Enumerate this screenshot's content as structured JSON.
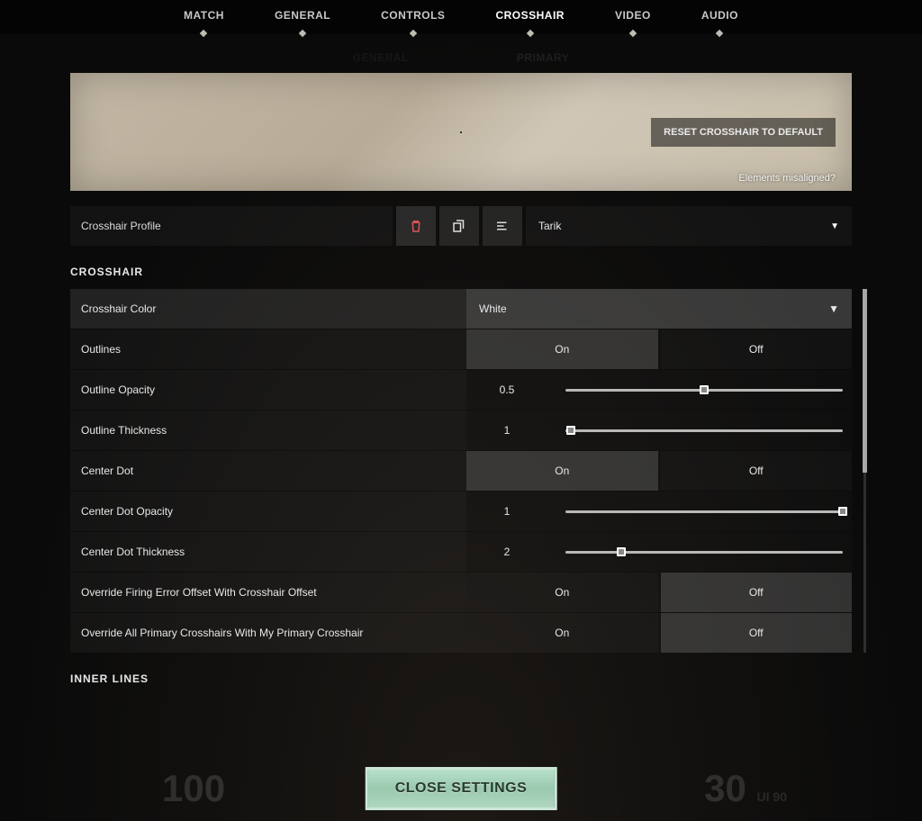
{
  "nav": {
    "tabs": [
      "MATCH",
      "GENERAL",
      "CONTROLS",
      "CROSSHAIR",
      "VIDEO",
      "AUDIO"
    ],
    "active": 3,
    "subtabs": [
      "GENERAL",
      "PRIMARY"
    ],
    "sub_active": 1
  },
  "preview": {
    "reset_label": "RESET CROSSHAIR TO DEFAULT",
    "misaligned_label": "Elements misaligned?"
  },
  "profile": {
    "label": "Crosshair Profile",
    "selected": "Tarik"
  },
  "section_crosshair_title": "CROSSHAIR",
  "section_inner_lines_title": "INNER LINES",
  "toggle_labels": {
    "on": "On",
    "off": "Off"
  },
  "rows": {
    "color": {
      "label": "Crosshair Color",
      "value": "White"
    },
    "outlines": {
      "label": "Outlines",
      "value": "On"
    },
    "out_opacity": {
      "label": "Outline Opacity",
      "value": "0.5",
      "percent": 50
    },
    "out_thick": {
      "label": "Outline Thickness",
      "value": "1",
      "percent": 2
    },
    "center_dot": {
      "label": "Center Dot",
      "value": "On"
    },
    "cd_opacity": {
      "label": "Center Dot Opacity",
      "value": "1",
      "percent": 100
    },
    "cd_thick": {
      "label": "Center Dot Thickness",
      "value": "2",
      "percent": 20
    },
    "ovr_firing": {
      "label": "Override Firing Error Offset With Crosshair Offset",
      "value": "Off"
    },
    "ovr_primary": {
      "label": "Override All Primary Crosshairs With My Primary Crosshair",
      "value": "Off"
    }
  },
  "close_btn_label": "CLOSE SETTINGS",
  "hud": {
    "health": "100",
    "ammo": "30",
    "ammo_reserve": "UI 90"
  }
}
